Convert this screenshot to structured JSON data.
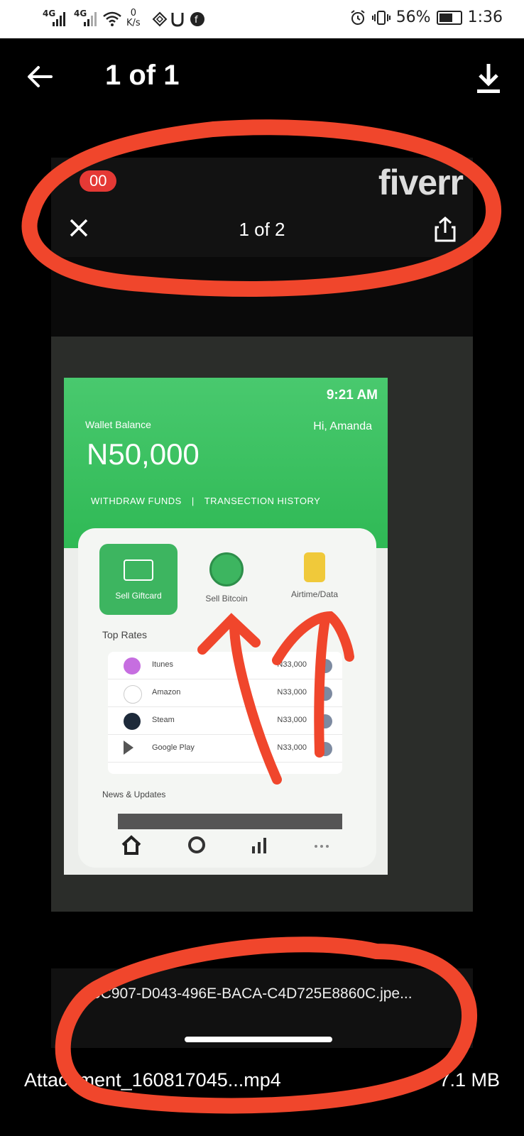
{
  "status_bar": {
    "signal_1": "4G",
    "signal_2": "4G",
    "net_speed_value": "0",
    "net_speed_unit": "K/s",
    "battery_percent": "56%",
    "time": "1:36"
  },
  "top_bar": {
    "title": "1 of 1"
  },
  "viewer": {
    "inner_title": "1 of 2",
    "rec_badge": "00",
    "logo": "fiverr",
    "phone": {
      "time": "9:21 AM",
      "wallet_label": "Wallet Balance",
      "greeting": "Hi, Amanda",
      "balance": "N50,000",
      "withdraw": "WITHDRAW FUNDS",
      "separator": "|",
      "history": "TRANSECTION HISTORY",
      "actions": [
        {
          "label": "Sell Giftcard"
        },
        {
          "label": "Sell Bitcoin"
        },
        {
          "label": "Airtime/Data"
        }
      ],
      "top_rates_heading": "Top Rates",
      "rates": [
        {
          "name": "Itunes",
          "value": "N33,000"
        },
        {
          "name": "Amazon",
          "value": "N33,000"
        },
        {
          "name": "Steam",
          "value": "N33,000"
        },
        {
          "name": "Google Play",
          "value": "N33,000"
        }
      ],
      "news_heading": "News & Updates"
    },
    "file_name": "5BC907-D043-496E-BACA-C4D725E8860C.jpe..."
  },
  "footer": {
    "attachment_name": "Attachment_160817045...mp4",
    "file_size": "7.1 MB"
  },
  "colors": {
    "annotation_red": "#f0462c",
    "wallet_green": "#3db560"
  }
}
